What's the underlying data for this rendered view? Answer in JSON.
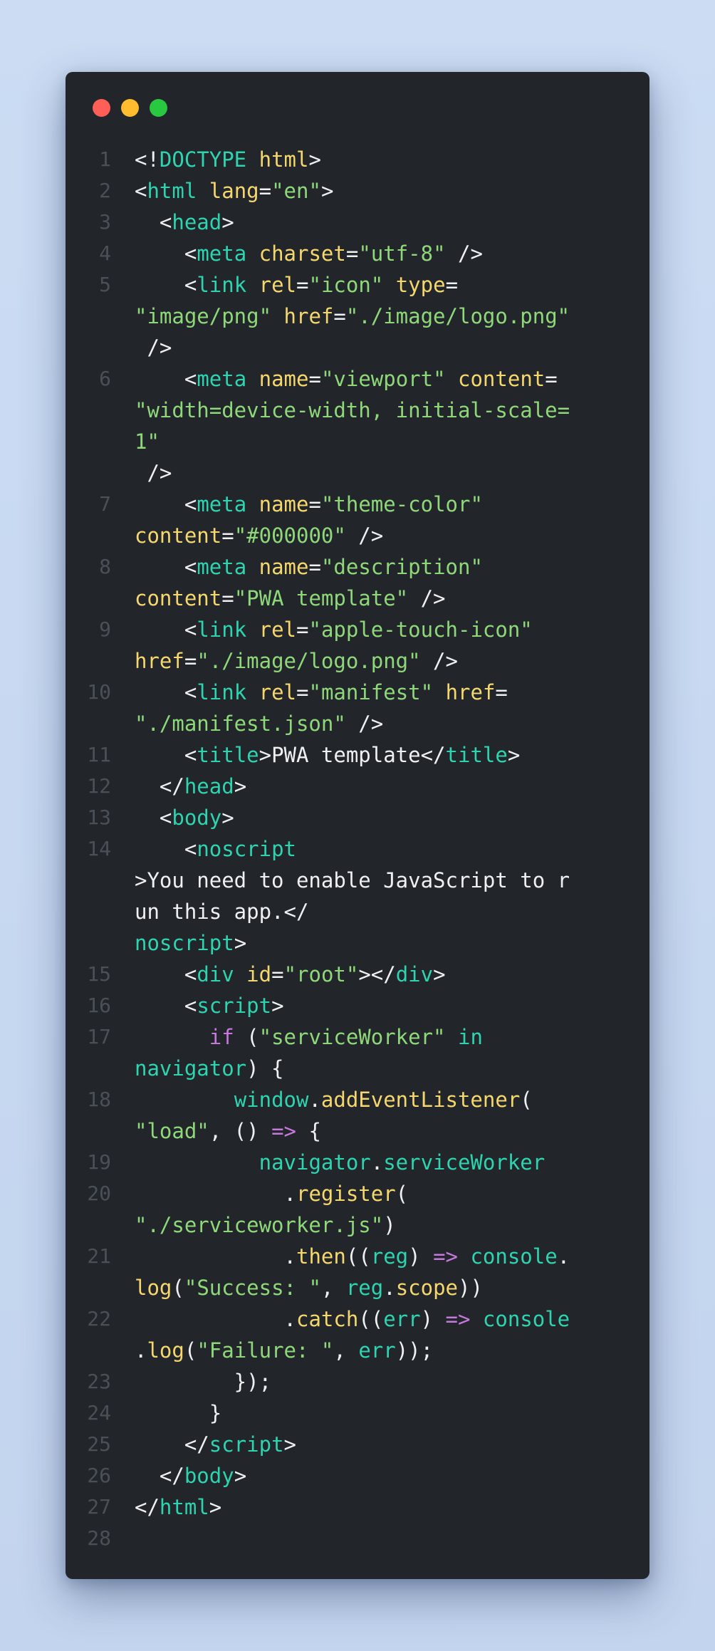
{
  "window": {
    "controls": {
      "close_color": "#ff5f57",
      "minimize_color": "#febc2e",
      "maximize_color": "#28c840"
    }
  },
  "theme": {
    "background": "#22262b",
    "tag": "#2ed3b0",
    "attribute": "#f5d76e",
    "string": "#8fd87a",
    "keyword": "#c678dd",
    "text": "#eef0f2",
    "line_number": "#4a5058"
  },
  "code": {
    "lines": [
      {
        "n": "1",
        "rows": [
          [
            [
              "p",
              "<!"
            ],
            [
              "tag",
              "DOCTYPE"
            ],
            [
              "p",
              " "
            ],
            [
              "attr",
              "html"
            ],
            [
              "p",
              ">"
            ]
          ]
        ]
      },
      {
        "n": "2",
        "rows": [
          [
            [
              "p",
              "<"
            ],
            [
              "tag",
              "html"
            ],
            [
              "p",
              " "
            ],
            [
              "attr",
              "lang"
            ],
            [
              "p",
              "="
            ],
            [
              "str",
              "\"en\""
            ],
            [
              "p",
              ">"
            ]
          ]
        ]
      },
      {
        "n": "3",
        "rows": [
          [
            [
              "p",
              "  <"
            ],
            [
              "tag",
              "head"
            ],
            [
              "p",
              ">"
            ]
          ]
        ]
      },
      {
        "n": "4",
        "rows": [
          [
            [
              "p",
              "    <"
            ],
            [
              "tag",
              "meta"
            ],
            [
              "p",
              " "
            ],
            [
              "attr",
              "charset"
            ],
            [
              "p",
              "="
            ],
            [
              "str",
              "\"utf-8\""
            ],
            [
              "p",
              " />"
            ]
          ]
        ]
      },
      {
        "n": "5",
        "rows": [
          [
            [
              "p",
              "    <"
            ],
            [
              "tag",
              "link"
            ],
            [
              "p",
              " "
            ],
            [
              "attr",
              "rel"
            ],
            [
              "p",
              "="
            ],
            [
              "str",
              "\"icon\""
            ],
            [
              "p",
              " "
            ],
            [
              "attr",
              "type"
            ],
            [
              "p",
              "="
            ]
          ],
          [
            [
              "str",
              "\"image/png\""
            ],
            [
              "p",
              " "
            ],
            [
              "attr",
              "href"
            ],
            [
              "p",
              "="
            ],
            [
              "str",
              "\"./image/logo.png\""
            ]
          ],
          [
            [
              "p",
              " />"
            ]
          ]
        ]
      },
      {
        "n": "6",
        "rows": [
          [
            [
              "p",
              "    <"
            ],
            [
              "tag",
              "meta"
            ],
            [
              "p",
              " "
            ],
            [
              "attr",
              "name"
            ],
            [
              "p",
              "="
            ],
            [
              "str",
              "\"viewport\""
            ],
            [
              "p",
              " "
            ],
            [
              "attr",
              "content"
            ],
            [
              "p",
              "="
            ]
          ],
          [
            [
              "str",
              "\"width=device-width, initial-scale="
            ]
          ],
          [
            [
              "str",
              "1\""
            ]
          ],
          [
            [
              "p",
              " />"
            ]
          ]
        ]
      },
      {
        "n": "7",
        "rows": [
          [
            [
              "p",
              "    <"
            ],
            [
              "tag",
              "meta"
            ],
            [
              "p",
              " "
            ],
            [
              "attr",
              "name"
            ],
            [
              "p",
              "="
            ],
            [
              "str",
              "\"theme-color\""
            ]
          ],
          [
            [
              "attr",
              "content"
            ],
            [
              "p",
              "="
            ],
            [
              "str",
              "\"#000000\""
            ],
            [
              "p",
              " />"
            ]
          ]
        ]
      },
      {
        "n": "8",
        "rows": [
          [
            [
              "p",
              "    <"
            ],
            [
              "tag",
              "meta"
            ],
            [
              "p",
              " "
            ],
            [
              "attr",
              "name"
            ],
            [
              "p",
              "="
            ],
            [
              "str",
              "\"description\""
            ]
          ],
          [
            [
              "attr",
              "content"
            ],
            [
              "p",
              "="
            ],
            [
              "str",
              "\"PWA template\""
            ],
            [
              "p",
              " />"
            ]
          ]
        ]
      },
      {
        "n": "9",
        "rows": [
          [
            [
              "p",
              "    <"
            ],
            [
              "tag",
              "link"
            ],
            [
              "p",
              " "
            ],
            [
              "attr",
              "rel"
            ],
            [
              "p",
              "="
            ],
            [
              "str",
              "\"apple-touch-icon\""
            ]
          ],
          [
            [
              "attr",
              "href"
            ],
            [
              "p",
              "="
            ],
            [
              "str",
              "\"./image/logo.png\""
            ],
            [
              "p",
              " />"
            ]
          ]
        ]
      },
      {
        "n": "10",
        "rows": [
          [
            [
              "p",
              "    <"
            ],
            [
              "tag",
              "link"
            ],
            [
              "p",
              " "
            ],
            [
              "attr",
              "rel"
            ],
            [
              "p",
              "="
            ],
            [
              "str",
              "\"manifest\""
            ],
            [
              "p",
              " "
            ],
            [
              "attr",
              "href"
            ],
            [
              "p",
              "="
            ]
          ],
          [
            [
              "str",
              "\"./manifest.json\""
            ],
            [
              "p",
              " />"
            ]
          ]
        ]
      },
      {
        "n": "11",
        "rows": [
          [
            [
              "p",
              "    <"
            ],
            [
              "tag",
              "title"
            ],
            [
              "p",
              ">PWA template</"
            ],
            [
              "tag",
              "title"
            ],
            [
              "p",
              ">"
            ]
          ]
        ]
      },
      {
        "n": "12",
        "rows": [
          [
            [
              "p",
              "  </"
            ],
            [
              "tag",
              "head"
            ],
            [
              "p",
              ">"
            ]
          ]
        ]
      },
      {
        "n": "13",
        "rows": [
          [
            [
              "p",
              "  <"
            ],
            [
              "tag",
              "body"
            ],
            [
              "p",
              ">"
            ]
          ]
        ]
      },
      {
        "n": "14",
        "rows": [
          [
            [
              "p",
              "    <"
            ],
            [
              "tag",
              "noscript"
            ]
          ],
          [
            [
              "p",
              ">You need to enable JavaScript to r"
            ]
          ],
          [
            [
              "p",
              "un this app.</"
            ]
          ],
          [
            [
              "tag",
              "noscript"
            ],
            [
              "p",
              ">"
            ]
          ]
        ]
      },
      {
        "n": "15",
        "rows": [
          [
            [
              "p",
              "    <"
            ],
            [
              "tag",
              "div"
            ],
            [
              "p",
              " "
            ],
            [
              "attr",
              "id"
            ],
            [
              "p",
              "="
            ],
            [
              "str",
              "\"root\""
            ],
            [
              "p",
              "></"
            ],
            [
              "tag",
              "div"
            ],
            [
              "p",
              ">"
            ]
          ]
        ]
      },
      {
        "n": "16",
        "rows": [
          [
            [
              "p",
              "    <"
            ],
            [
              "tag",
              "script"
            ],
            [
              "p",
              ">"
            ]
          ]
        ]
      },
      {
        "n": "17",
        "rows": [
          [
            [
              "p",
              "      "
            ],
            [
              "kw",
              "if"
            ],
            [
              "p",
              " ("
            ],
            [
              "str",
              "\"serviceWorker\""
            ],
            [
              "p",
              " "
            ],
            [
              "tag",
              "in"
            ]
          ],
          [
            [
              "id",
              "navigator"
            ],
            [
              "p",
              ") {"
            ]
          ]
        ]
      },
      {
        "n": "18",
        "rows": [
          [
            [
              "p",
              "        "
            ],
            [
              "id",
              "window"
            ],
            [
              "p",
              "."
            ],
            [
              "fn",
              "addEventListener"
            ],
            [
              "p",
              "("
            ]
          ],
          [
            [
              "str",
              "\"load\""
            ],
            [
              "p",
              ", () "
            ],
            [
              "kw",
              "=>"
            ],
            [
              "p",
              " {"
            ]
          ]
        ]
      },
      {
        "n": "19",
        "rows": [
          [
            [
              "p",
              "          "
            ],
            [
              "id",
              "navigator"
            ],
            [
              "p",
              "."
            ],
            [
              "id",
              "serviceWorker"
            ]
          ]
        ]
      },
      {
        "n": "20",
        "rows": [
          [
            [
              "p",
              "            ."
            ],
            [
              "fn",
              "register"
            ],
            [
              "p",
              "("
            ]
          ],
          [
            [
              "str",
              "\"./serviceworker.js\""
            ],
            [
              "p",
              ")"
            ]
          ]
        ]
      },
      {
        "n": "21",
        "rows": [
          [
            [
              "p",
              "            ."
            ],
            [
              "fn",
              "then"
            ],
            [
              "p",
              "(("
            ],
            [
              "id",
              "reg"
            ],
            [
              "p",
              ") "
            ],
            [
              "kw",
              "=>"
            ],
            [
              "p",
              " "
            ],
            [
              "id",
              "console"
            ],
            [
              "p",
              "."
            ]
          ],
          [
            [
              "fn",
              "log"
            ],
            [
              "p",
              "("
            ],
            [
              "str",
              "\"Success: \""
            ],
            [
              "p",
              ", "
            ],
            [
              "id",
              "reg"
            ],
            [
              "p",
              "."
            ],
            [
              "fn",
              "scope"
            ],
            [
              "p",
              "))"
            ]
          ]
        ]
      },
      {
        "n": "22",
        "rows": [
          [
            [
              "p",
              "            ."
            ],
            [
              "fn",
              "catch"
            ],
            [
              "p",
              "(("
            ],
            [
              "id",
              "err"
            ],
            [
              "p",
              ") "
            ],
            [
              "kw",
              "=>"
            ],
            [
              "p",
              " "
            ],
            [
              "id",
              "console"
            ]
          ],
          [
            [
              "p",
              "."
            ],
            [
              "fn",
              "log"
            ],
            [
              "p",
              "("
            ],
            [
              "str",
              "\"Failure: \""
            ],
            [
              "p",
              ", "
            ],
            [
              "id",
              "err"
            ],
            [
              "p",
              "));"
            ]
          ]
        ]
      },
      {
        "n": "23",
        "rows": [
          [
            [
              "p",
              "        });"
            ]
          ]
        ]
      },
      {
        "n": "24",
        "rows": [
          [
            [
              "p",
              "      }"
            ]
          ]
        ]
      },
      {
        "n": "25",
        "rows": [
          [
            [
              "p",
              "    </"
            ],
            [
              "tag",
              "script"
            ],
            [
              "p",
              ">"
            ]
          ]
        ]
      },
      {
        "n": "26",
        "rows": [
          [
            [
              "p",
              "  </"
            ],
            [
              "tag",
              "body"
            ],
            [
              "p",
              ">"
            ]
          ]
        ]
      },
      {
        "n": "27",
        "rows": [
          [
            [
              "p",
              "</"
            ],
            [
              "tag",
              "html"
            ],
            [
              "p",
              ">"
            ]
          ]
        ]
      },
      {
        "n": "28",
        "rows": [
          [
            [
              "p",
              ""
            ]
          ]
        ]
      }
    ]
  }
}
